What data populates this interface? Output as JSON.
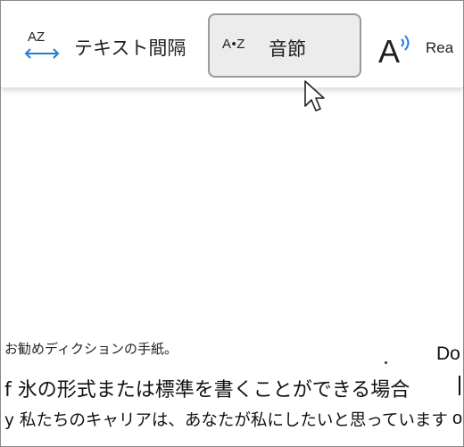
{
  "toolbar": {
    "text_spacing": {
      "icon_letters": "AZ",
      "label": "テキスト間隔"
    },
    "syllables": {
      "icon_text": "A•Z",
      "label": "音節",
      "state": "hover"
    },
    "read_aloud": {
      "label": "Rea"
    }
  },
  "document": {
    "caption": "お勧めディクションの手紙。",
    "line1": "f 氷の形式または標準を書くことができる場合",
    "line2": "y 私たちのキャリアは、あなたが私にしたいと思っています",
    "right_fragment_top": "Do",
    "right_fragment_bottom": "o"
  },
  "colors": {
    "accent_blue": "#1e7fd6",
    "hover_bg": "#ececec",
    "hover_border": "#9a9a9a"
  }
}
